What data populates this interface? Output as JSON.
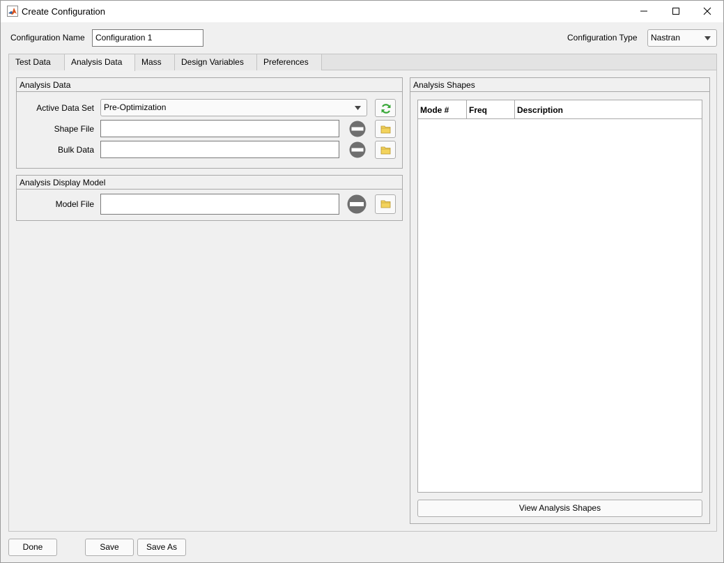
{
  "window": {
    "title": "Create Configuration",
    "icons": {
      "app": "matlab-icon",
      "minimize": "minimize-icon",
      "maximize": "maximize-icon",
      "close": "close-icon"
    }
  },
  "header": {
    "config_name_label": "Configuration Name",
    "config_name_value": "Configuration 1",
    "config_type_label": "Configuration Type",
    "config_type_value": "Nastran"
  },
  "tabs": [
    {
      "label": "Test Data",
      "active": false
    },
    {
      "label": "Analysis Data",
      "active": true
    },
    {
      "label": "Mass",
      "active": false
    },
    {
      "label": "Design Variables",
      "active": false
    },
    {
      "label": "Preferences",
      "active": false
    }
  ],
  "analysis_data": {
    "title": "Analysis Data",
    "active_data_set_label": "Active Data Set",
    "active_data_set_value": "Pre-Optimization",
    "shape_file_label": "Shape File",
    "shape_file_value": "",
    "bulk_data_label": "Bulk Data",
    "bulk_data_value": ""
  },
  "display_model": {
    "title": "Analysis Display Model",
    "model_file_label": "Model File",
    "model_file_value": ""
  },
  "analysis_shapes": {
    "title": "Analysis Shapes",
    "columns": [
      "Mode #",
      "Freq",
      "Description"
    ],
    "rows": [],
    "view_button": "View Analysis Shapes"
  },
  "footer": {
    "done": "Done",
    "save": "Save",
    "save_as": "Save As"
  },
  "colors": {
    "refresh_green": "#3aa83a",
    "folder_yellow": "#f3d35c",
    "clear_gray": "#6f6f6f"
  }
}
